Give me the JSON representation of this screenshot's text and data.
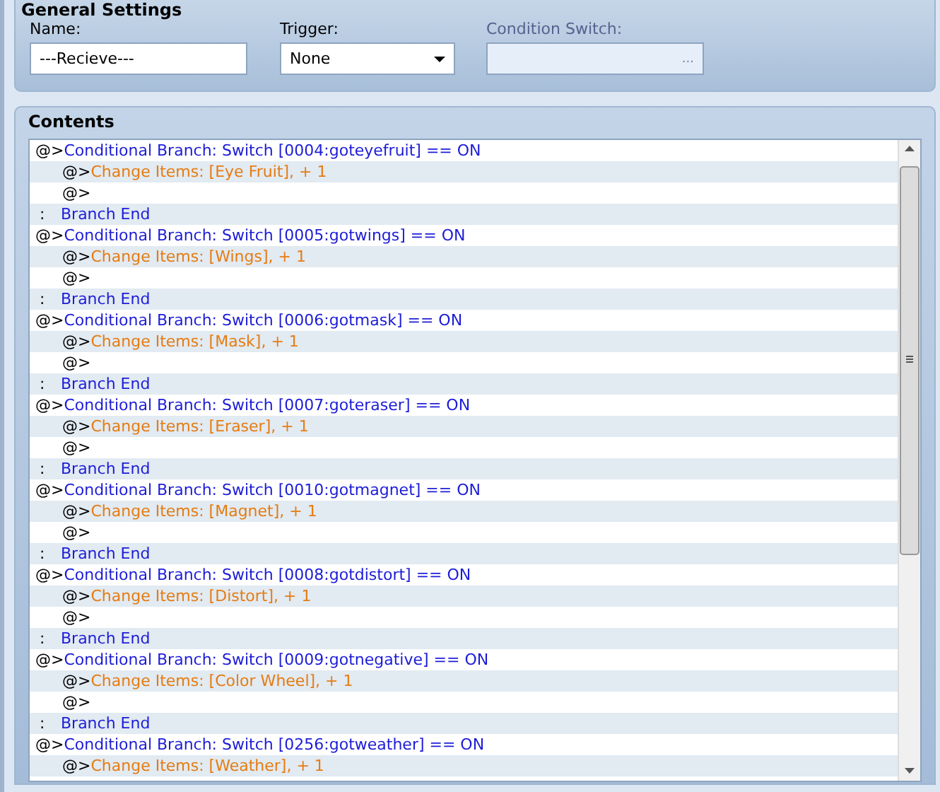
{
  "general_settings": {
    "title": "General Settings",
    "name": {
      "label": "Name:",
      "value": "---Recieve---"
    },
    "trigger": {
      "label": "Trigger:",
      "value": "None"
    },
    "condition_switch": {
      "label": "Condition Switch:",
      "button": "...",
      "disabled": true
    }
  },
  "contents": {
    "title": "Contents",
    "rows": [
      {
        "kind": "branch",
        "prefix": "@>",
        "text": "Conditional Branch: Switch [0004:goteyefruit] == ON",
        "children": [
          {
            "kind": "command",
            "prefix": "@>",
            "text": "Change Items: [Eye Fruit], + 1"
          },
          {
            "kind": "empty",
            "prefix": "@>"
          }
        ]
      },
      {
        "kind": "end",
        "prefix": ":",
        "text": "Branch End"
      },
      {
        "kind": "branch",
        "prefix": "@>",
        "text": "Conditional Branch: Switch [0005:gotwings] == ON",
        "children": [
          {
            "kind": "command",
            "prefix": "@>",
            "text": "Change Items: [Wings], + 1"
          },
          {
            "kind": "empty",
            "prefix": "@>"
          }
        ]
      },
      {
        "kind": "end",
        "prefix": ":",
        "text": "Branch End"
      },
      {
        "kind": "branch",
        "prefix": "@>",
        "text": "Conditional Branch: Switch [0006:gotmask] == ON",
        "children": [
          {
            "kind": "command",
            "prefix": "@>",
            "text": "Change Items: [Mask], + 1"
          },
          {
            "kind": "empty",
            "prefix": "@>"
          }
        ]
      },
      {
        "kind": "end",
        "prefix": ":",
        "text": "Branch End"
      },
      {
        "kind": "branch",
        "prefix": "@>",
        "text": "Conditional Branch: Switch [0007:goteraser] == ON",
        "children": [
          {
            "kind": "command",
            "prefix": "@>",
            "text": "Change Items: [Eraser], + 1"
          },
          {
            "kind": "empty",
            "prefix": "@>"
          }
        ]
      },
      {
        "kind": "end",
        "prefix": ":",
        "text": "Branch End"
      },
      {
        "kind": "branch",
        "prefix": "@>",
        "text": "Conditional Branch: Switch [0010:gotmagnet] == ON",
        "children": [
          {
            "kind": "command",
            "prefix": "@>",
            "text": "Change Items: [Magnet], + 1"
          },
          {
            "kind": "empty",
            "prefix": "@>"
          }
        ]
      },
      {
        "kind": "end",
        "prefix": ":",
        "text": "Branch End"
      },
      {
        "kind": "branch",
        "prefix": "@>",
        "text": "Conditional Branch: Switch [0008:gotdistort] == ON",
        "children": [
          {
            "kind": "command",
            "prefix": "@>",
            "text": "Change Items: [Distort], + 1"
          },
          {
            "kind": "empty",
            "prefix": "@>"
          }
        ]
      },
      {
        "kind": "end",
        "prefix": ":",
        "text": "Branch End"
      },
      {
        "kind": "branch",
        "prefix": "@>",
        "text": "Conditional Branch: Switch [0009:gotnegative] == ON",
        "children": [
          {
            "kind": "command",
            "prefix": "@>",
            "text": "Change Items: [Color Wheel], + 1"
          },
          {
            "kind": "empty",
            "prefix": "@>"
          }
        ]
      },
      {
        "kind": "end",
        "prefix": ":",
        "text": "Branch End"
      },
      {
        "kind": "branch",
        "prefix": "@>",
        "text": "Conditional Branch: Switch [0256:gotweather] == ON",
        "children": [
          {
            "kind": "command",
            "prefix": "@>",
            "text": "Change Items: [Weather], + 1"
          }
        ]
      }
    ]
  }
}
